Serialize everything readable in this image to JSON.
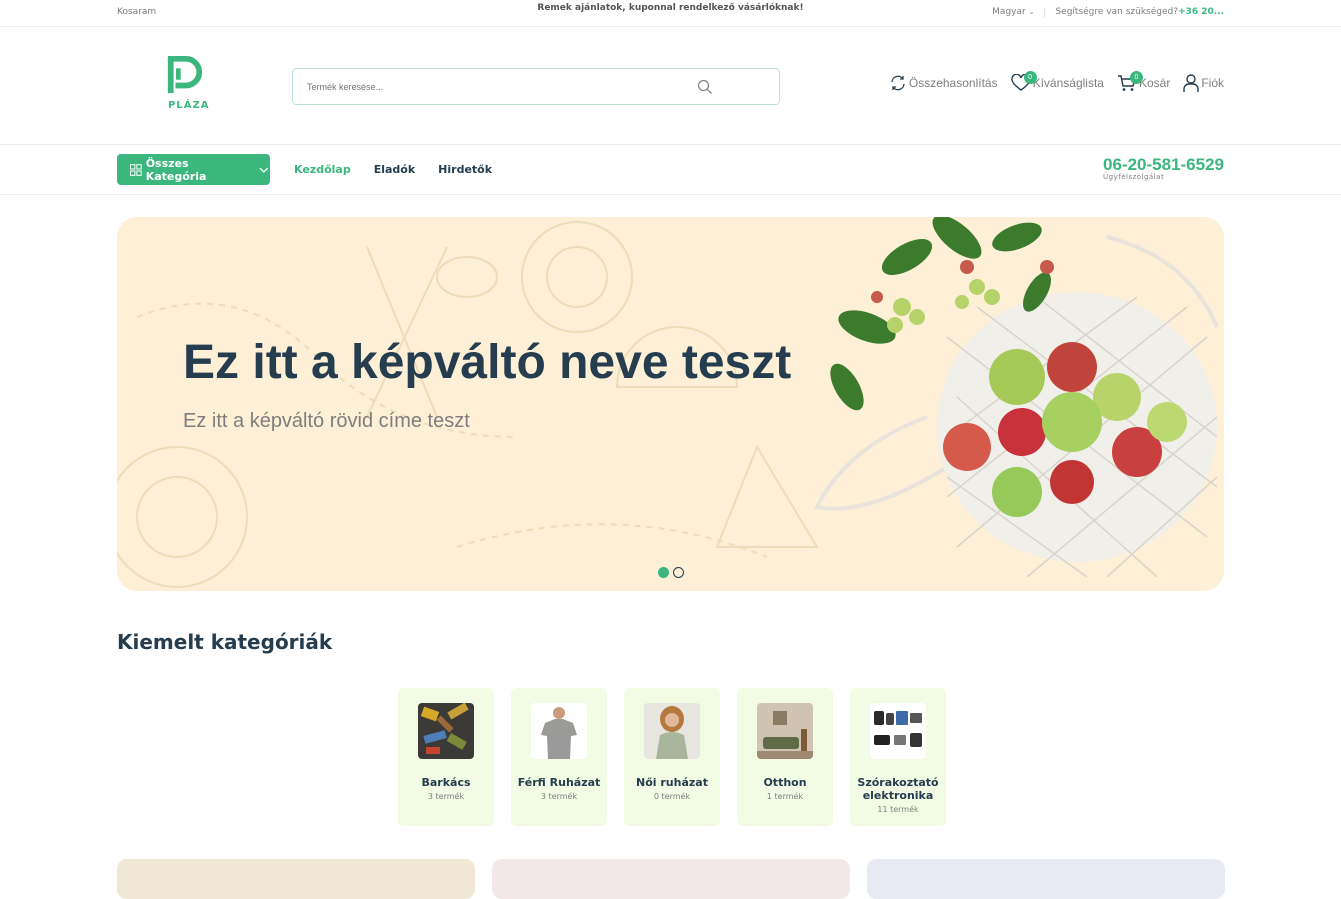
{
  "topbar": {
    "cart_link": "Kosaram",
    "promo": "Remek ajánlatok, kuponnal rendelkező vásárlóknak!",
    "language": "Magyar",
    "help_text": "Segítségre van szükséged?",
    "help_phone": "+36 20..."
  },
  "header": {
    "logo_text": "PLÁZA",
    "search_placeholder": "Termék keresése...",
    "actions": {
      "compare": "Összehasonlítás",
      "wishlist": "Kívánságlista",
      "wishlist_count": "0",
      "cart": "Kosár",
      "cart_count": "0",
      "account": "Fiók"
    }
  },
  "nav": {
    "all_categories": "Összes Kategória",
    "links": [
      "Kezdőlap",
      "Eladók",
      "Hirdetők"
    ],
    "phone": "06-20-581-6529",
    "phone_label": "Ügyfélszolgálat"
  },
  "hero": {
    "title": "Ez itt a képváltó neve teszt",
    "subtitle": "Ez itt a képváltó rövid címe teszt",
    "slides": 2,
    "active_slide": 1
  },
  "featured": {
    "title": "Kiemelt kategóriák",
    "categories": [
      {
        "name": "Barkács",
        "count": "3 termék"
      },
      {
        "name": "Férfi Ruházat",
        "count": "3 termék"
      },
      {
        "name": "Női ruházat",
        "count": "0 termék"
      },
      {
        "name": "Otthon",
        "count": "1 termék"
      },
      {
        "name": "Szórakoztató elektronika",
        "count": "11 termék"
      }
    ]
  },
  "colors": {
    "brand": "#3bb77e",
    "heading": "#253d4e",
    "hero_bg": "#fdf0d6",
    "category_bg": "#f2fce4"
  }
}
